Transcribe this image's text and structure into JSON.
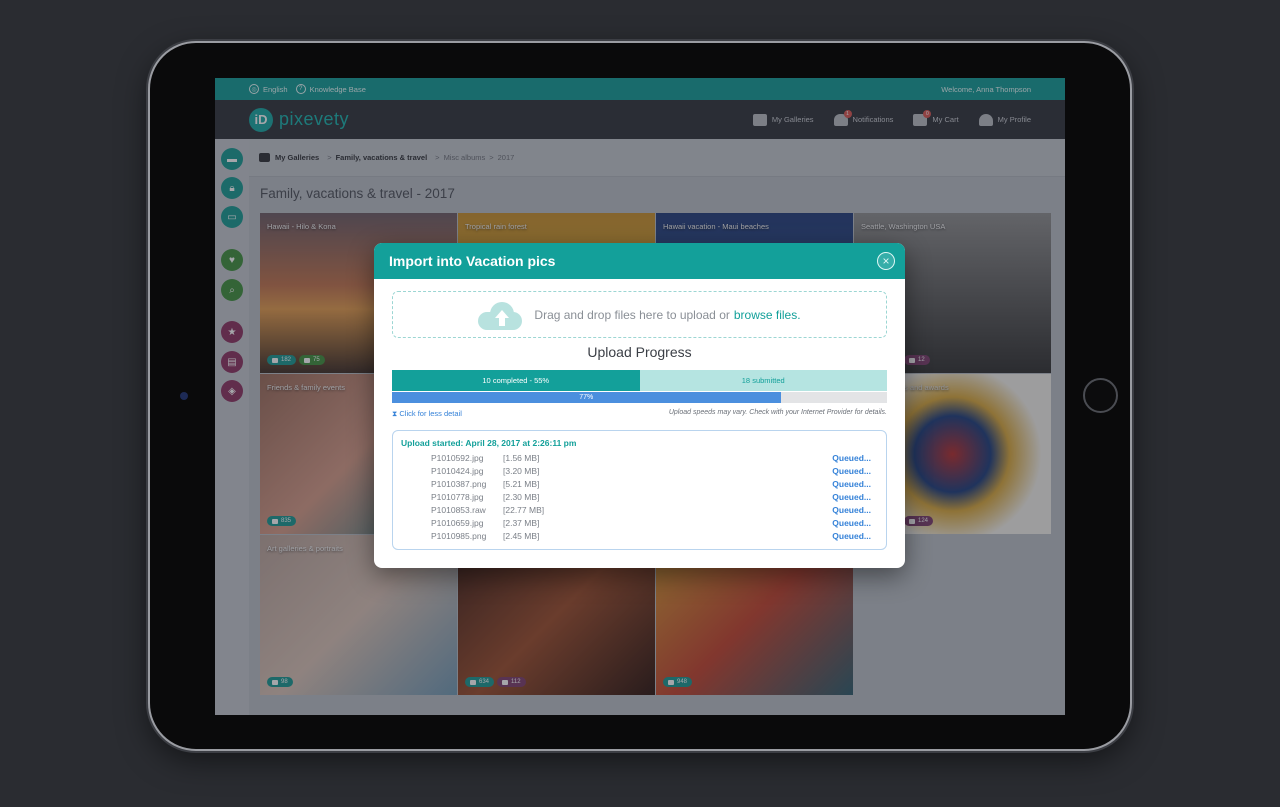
{
  "topstrip": {
    "language": "English",
    "knowledge_base": "Knowledge Base",
    "welcome": "Welcome,  Anna Thompson"
  },
  "logo": {
    "mark": "iD",
    "text": "pixevety"
  },
  "nav": {
    "galleries": "My Galleries",
    "notifications": "Notifications",
    "notifications_count": "1",
    "cart": "My Cart",
    "cart_count": "0",
    "profile": "My Profile"
  },
  "breadcrumb": {
    "root": "My Galleries",
    "level1": "Family, vacations & travel",
    "level2": "Misc albums",
    "level3": "2017"
  },
  "page_title": "Family, vacations & travel - 2017",
  "tiles": [
    {
      "label": "Hawaii - Hilo & Kona",
      "photos": "182",
      "videos": "75"
    },
    {
      "label": "Tropical rain forest"
    },
    {
      "label": "Hawaii vacation - Maui beaches"
    },
    {
      "label": "Seattle, Washington USA",
      "photos": "12"
    },
    {
      "label": "Friends & family events",
      "photos": "835"
    },
    {
      "label": "ts and awards",
      "photos": "124"
    },
    {
      "label": "Art galleries & portraits",
      "photos": "98"
    },
    {
      "label": "",
      "photos": "634",
      "audio": "112"
    },
    {
      "label": "",
      "photos": "948"
    }
  ],
  "modal": {
    "title": "Import into Vacation pics",
    "close": "×",
    "dropzone_text": "Drag and drop files here to upload or",
    "browse_link": "browse files.",
    "progress_title": "Upload Progress",
    "completed_label": "10 completed - 55%",
    "submitted_label": "18 submitted",
    "completed_fraction": 0.5,
    "current_label": "77%",
    "current_fraction": 0.785,
    "detail_link": "Click for less detail",
    "speed_note": "Upload speeds may vary. Check with your Internet Provider for details.",
    "log_header": "Upload started: April 28, 2017 at 2:26:11 pm",
    "files": [
      {
        "name": "P1010592.jpg",
        "size": "[1.56 MB]",
        "status": "Queued..."
      },
      {
        "name": "P1010424.jpg",
        "size": "[3.20 MB]",
        "status": "Queued..."
      },
      {
        "name": "P1010387.png",
        "size": "[5.21 MB]",
        "status": "Queued..."
      },
      {
        "name": "P1010778.jpg",
        "size": "[2.30 MB]",
        "status": "Queued..."
      },
      {
        "name": "P1010853.raw",
        "size": "[22.77 MB]",
        "status": "Queued..."
      },
      {
        "name": "P1010659.jpg",
        "size": "[2.37 MB]",
        "status": "Queued..."
      },
      {
        "name": "P1010985.png",
        "size": "[2.45 MB]",
        "status": "Queued..."
      }
    ]
  },
  "colors": {
    "accent": "#13a09a",
    "link": "#3582d8",
    "progress_blue": "#4b8fde"
  }
}
